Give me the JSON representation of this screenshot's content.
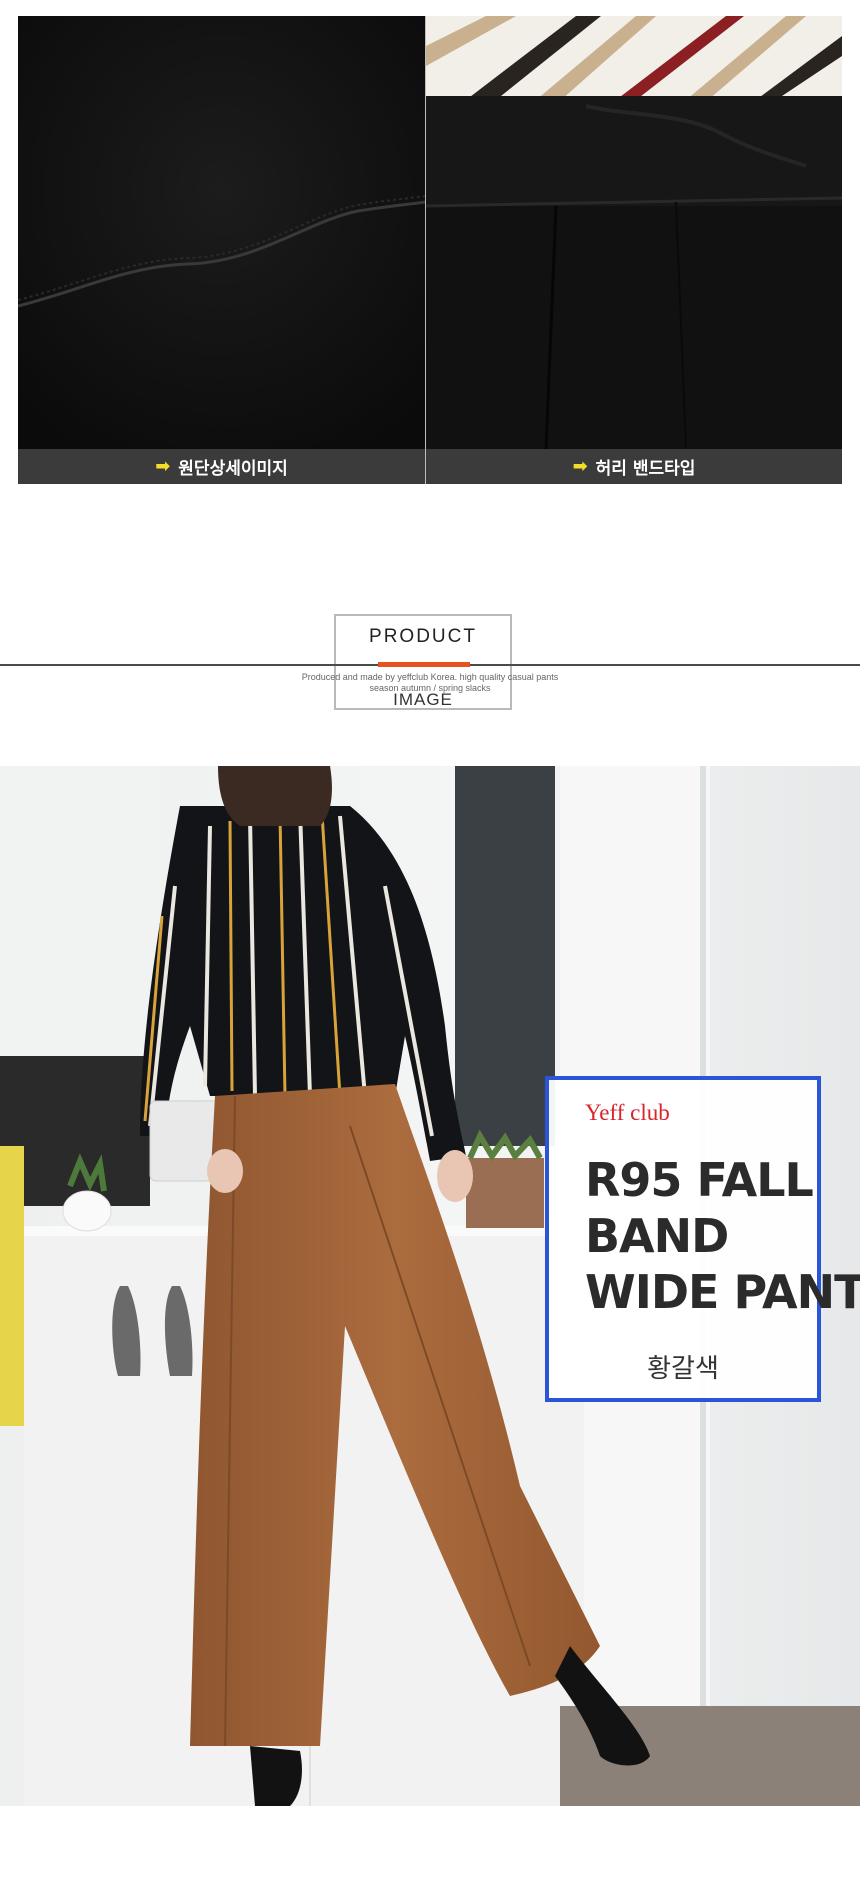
{
  "details": {
    "left_caption": "원단상세이미지",
    "right_caption": "허리 밴드타입"
  },
  "section_header": {
    "title_top": "PRODUCT",
    "title_bottom": "IMAGE",
    "subtitle_line1": "Produced and made by yeffclub Korea. high quality casual pants",
    "subtitle_line2": "season autumn / spring slacks"
  },
  "product_tag": {
    "brand": "Yeff club",
    "name_line1": "R95 FALL",
    "name_line2": "BAND",
    "name_line3": "WIDE PANTS",
    "color_name": "황갈색"
  },
  "colors": {
    "caption_bg": "#3b3b3b",
    "arrow": "#f3dc2a",
    "accent": "#e8501e",
    "tag_border": "#2a55d8",
    "brand_red": "#d8242a",
    "pants": "#a8683a"
  },
  "icons": [
    "arrow-right-icon"
  ]
}
